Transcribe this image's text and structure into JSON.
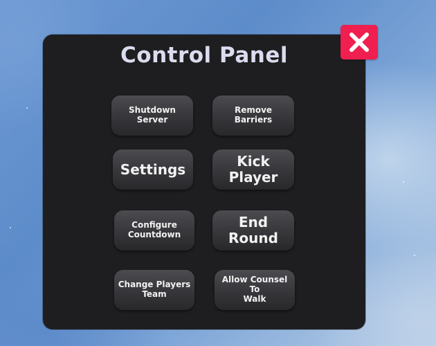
{
  "panel": {
    "title": "Control Panel",
    "close_icon": "close-x-icon",
    "accent_color": "#ef1f4f"
  },
  "buttons": {
    "shutdown_server": "Shutdown Server",
    "remove_barriers": "Remove Barriers",
    "settings": "Settings",
    "kick_player": "Kick Player",
    "configure_countdown_line1": "Configure",
    "configure_countdown_line2": "Countdown",
    "end_round": "End Round",
    "change_players_team_line1": "Change Players",
    "change_players_team_line2": "Team",
    "allow_counsel_line1": "Allow Counsel To",
    "allow_counsel_line2": "Walk"
  }
}
